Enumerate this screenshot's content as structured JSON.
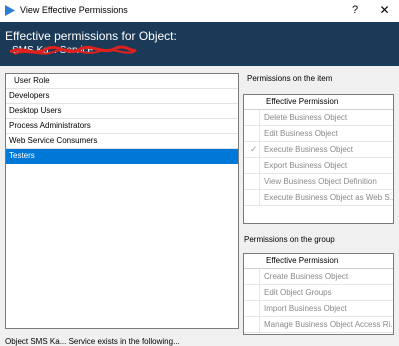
{
  "window": {
    "title": "View Effective Permissions",
    "help": "?",
    "close": "✕"
  },
  "header": {
    "title": "Effective permissions for Object:",
    "object": "SMS Ka... Service"
  },
  "roles": {
    "column_header": "User Role",
    "items": [
      "Developers",
      "Desktop Users",
      "Process Administrators",
      "Web Service Consumers",
      "Testers"
    ],
    "selected": "Testers"
  },
  "item_permissions": {
    "label": "Permissions on the item",
    "column_header": "Effective Permission",
    "rows": [
      {
        "name": "Delete Business Object",
        "checked": false
      },
      {
        "name": "Edit Business Object",
        "checked": false
      },
      {
        "name": "Execute Business Object",
        "checked": true
      },
      {
        "name": "Export Business Object",
        "checked": false
      },
      {
        "name": "View Business Object Definition",
        "checked": false
      },
      {
        "name": "Execute Business Object as Web S...",
        "checked": false
      }
    ]
  },
  "group_permissions": {
    "label": "Permissions on the group",
    "column_header": "Effective Permission",
    "rows": [
      {
        "name": "Create Business Object"
      },
      {
        "name": "Edit Object Groups"
      },
      {
        "name": "Import Business Object"
      },
      {
        "name": "Manage Business Object Access Ri..."
      }
    ]
  },
  "footer": {
    "text": "Object SMS Ka... Service exists in the following..."
  },
  "colors": {
    "header_bg": "#1b3a57",
    "selection": "#0078d7",
    "scribble": "#e0201c"
  }
}
